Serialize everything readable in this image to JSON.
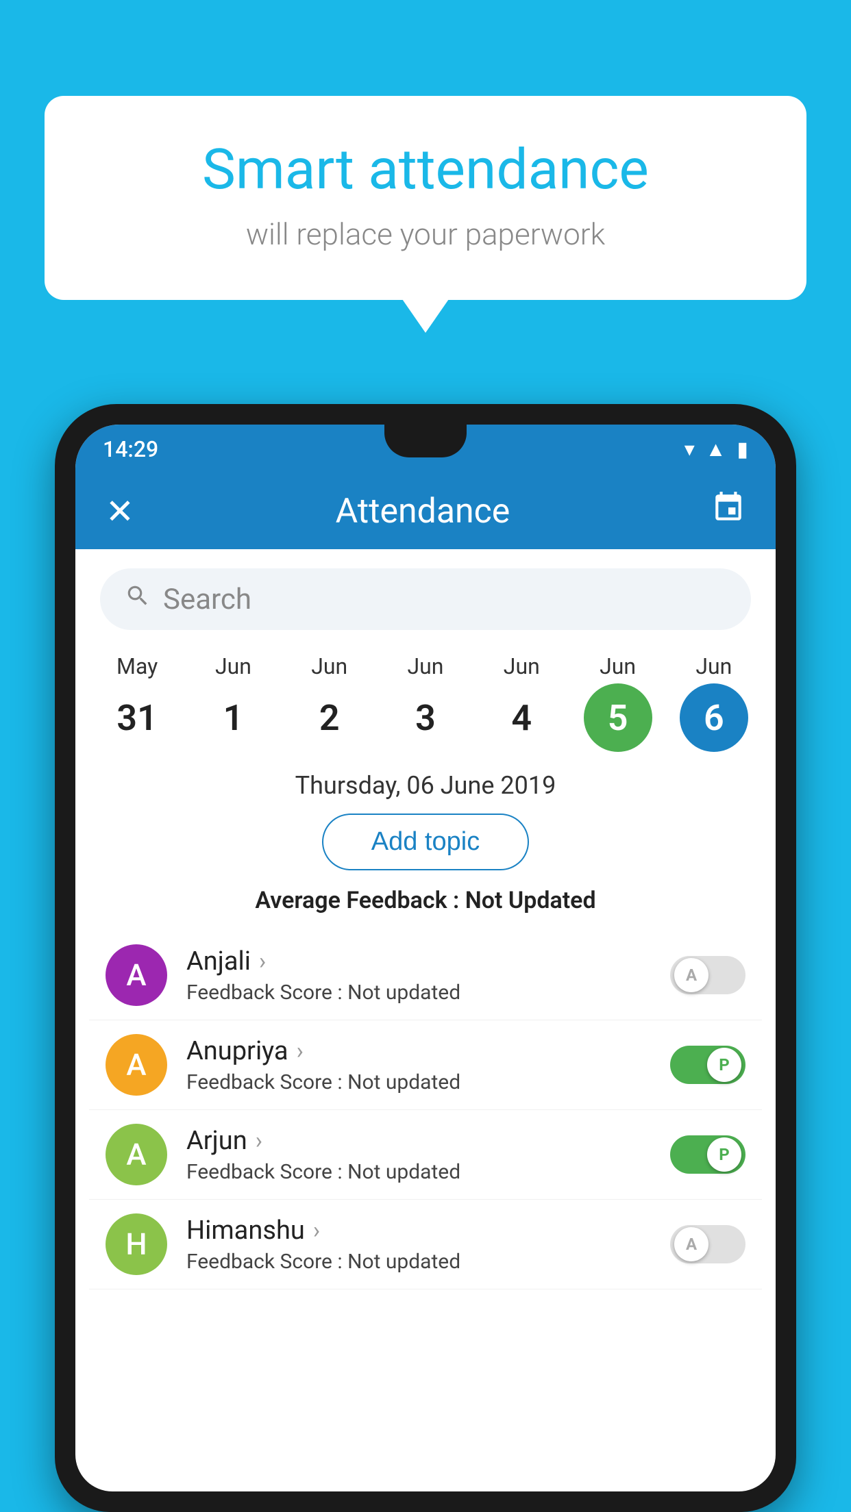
{
  "background_color": "#1ab8e8",
  "speech_bubble": {
    "title": "Smart attendance",
    "subtitle": "will replace your paperwork"
  },
  "status_bar": {
    "time": "14:29",
    "icons": [
      "wifi",
      "signal",
      "battery"
    ]
  },
  "app_bar": {
    "close_label": "✕",
    "title": "Attendance",
    "calendar_icon": "📅"
  },
  "search": {
    "placeholder": "Search"
  },
  "calendar": {
    "days": [
      {
        "month": "May",
        "date": "31",
        "highlight": "none"
      },
      {
        "month": "Jun",
        "date": "1",
        "highlight": "none"
      },
      {
        "month": "Jun",
        "date": "2",
        "highlight": "none"
      },
      {
        "month": "Jun",
        "date": "3",
        "highlight": "none"
      },
      {
        "month": "Jun",
        "date": "4",
        "highlight": "none"
      },
      {
        "month": "Jun",
        "date": "5",
        "highlight": "green"
      },
      {
        "month": "Jun",
        "date": "6",
        "highlight": "blue"
      }
    ]
  },
  "selected_date": "Thursday, 06 June 2019",
  "add_topic_label": "Add topic",
  "average_feedback": {
    "label": "Average Feedback : ",
    "value": "Not Updated"
  },
  "students": [
    {
      "name": "Anjali",
      "avatar_letter": "A",
      "avatar_color": "#9c27b0",
      "feedback_label": "Feedback Score : ",
      "feedback_value": "Not updated",
      "toggle_state": "off",
      "toggle_label": "A"
    },
    {
      "name": "Anupriya",
      "avatar_letter": "A",
      "avatar_color": "#f5a623",
      "feedback_label": "Feedback Score : ",
      "feedback_value": "Not updated",
      "toggle_state": "on",
      "toggle_label": "P"
    },
    {
      "name": "Arjun",
      "avatar_letter": "A",
      "avatar_color": "#8bc34a",
      "feedback_label": "Feedback Score : ",
      "feedback_value": "Not updated",
      "toggle_state": "on",
      "toggle_label": "P"
    },
    {
      "name": "Himanshu",
      "avatar_letter": "H",
      "avatar_color": "#8bc34a",
      "feedback_label": "Feedback Score : ",
      "feedback_value": "Not updated",
      "toggle_state": "off",
      "toggle_label": "A"
    }
  ]
}
